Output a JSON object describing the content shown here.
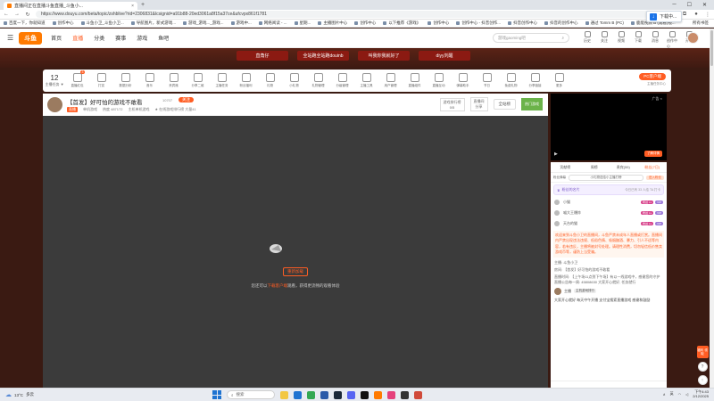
{
  "browser": {
    "tab_title": "直播间正在直播斗鱼直播_斗鱼小...",
    "new_tab": "+",
    "url": "https://www.douyu.com/beta/topic/zshblive?rid=2306831&lcsignid=a91b88-20ed3061a8f15a37ce&ufcvpx861f1781",
    "download_popup": "下载中...",
    "bookmarks": [
      "百度一下，你就知道",
      "创作中心",
      "斗鱼小卫_斗鱼小卫...",
      "导航图片，新式游戏...",
      "游戏_游戏..._游戏...",
      "游戏中...",
      "网络阅读 - ...",
      "星期...",
      "主播图片中心",
      "创作中心",
      "以下推荐《游戏》",
      "创作中心",
      "创作中心 - 抖音创作...",
      "抖音创作中心",
      "抖音的创作中心",
      "通过 Tomm B (PC)",
      "鹿能视频 B (观看)视..."
    ],
    "bookmarks_right": "所有书签"
  },
  "header": {
    "logo": "斗鱼",
    "nav": [
      "首页",
      "直播",
      "分类",
      "赛事",
      "游戏",
      "鱼吧"
    ],
    "active_nav": "直播",
    "search_placeholder": "游戏gaoming吧",
    "icons": [
      {
        "name": "history",
        "label": "历史"
      },
      {
        "name": "follow",
        "label": "关注"
      },
      {
        "name": "video",
        "label": "视频"
      },
      {
        "name": "download",
        "label": "下载"
      },
      {
        "name": "message",
        "label": "消息"
      },
      {
        "name": "creator",
        "label": "创作中心"
      },
      {
        "name": "broadcast",
        "label": "开播"
      }
    ]
  },
  "banner": {
    "buttons": [
      "直角仔",
      "全站跑全站跑douinb",
      "叫我你我就好了",
      "diyy刘醒"
    ]
  },
  "gift_bar": {
    "level_value": "12",
    "level_label": "主播任务 ▼",
    "gifts": [
      {
        "label": "直播红包",
        "badge": "3"
      },
      {
        "label": "打赏",
        "badge": ""
      },
      {
        "label": "数据分析",
        "badge": ""
      },
      {
        "label": "音乐",
        "badge": ""
      },
      {
        "label": "贵宾席",
        "badge": ""
      },
      {
        "label": "分享二维",
        "badge": ""
      },
      {
        "label": "主播任务",
        "badge": ""
      },
      {
        "label": "粉丝福利",
        "badge": ""
      },
      {
        "label": "礼物",
        "badge": ""
      },
      {
        "label": "小礼物",
        "badge": ""
      },
      {
        "label": "礼物管理",
        "badge": ""
      },
      {
        "label": "分级管理",
        "badge": ""
      },
      {
        "label": "主播工具",
        "badge": ""
      },
      {
        "label": "用户管理",
        "badge": ""
      },
      {
        "label": "直播组件",
        "badge": ""
      },
      {
        "label": "直播互动",
        "badge": ""
      },
      {
        "label": "弹幕助手",
        "badge": ""
      },
      {
        "label": "节日",
        "badge": ""
      },
      {
        "label": "免费礼物",
        "badge": ""
      },
      {
        "label": "分享链接",
        "badge": ""
      },
      {
        "label": "更多",
        "badge": ""
      }
    ],
    "pc_client": "PC客户端",
    "pc_sub": "主播任务中心"
  },
  "room": {
    "title": "【首发】好可怕的游戏不敢看",
    "follow_count": "10707",
    "follow_label": "关注",
    "live_tag": "直播",
    "category": "单机游戏",
    "meta": [
      "热度 487172",
      "主机单机游戏",
      "★ 在线游戏排行榜 大量41"
    ],
    "right_box_top": "游戏排行榜",
    "right_box_bottom": "0/5",
    "right_btn1": "直播间",
    "right_btn2": "分享",
    "right_btn3": "全站榜",
    "ad": "热门游戏"
  },
  "player": {
    "reload": "重新加载",
    "tip_before": "您还可以",
    "tip_link": "下载客户端",
    "tip_after": "观看，获得更流畅的观看体验"
  },
  "right_ad": {
    "label": "广告 ×",
    "btn": "了解详情"
  },
  "chat": {
    "tabs": [
      "贡献榜",
      "周榜",
      "贵宾(55)",
      "粉丝(7日)"
    ],
    "active_tab": "粉丝(7日)",
    "fan_row": [
      "粉丝弹幕",
      "小礼物送给小主播打榜",
      "进入粉丝"
    ],
    "fan_card_title": "粉丝的名片",
    "fan_card_sub": "今日已有 33 人给 TA 打卡",
    "ranks": [
      {
        "name": "小猫",
        "b1": "粉丝 Lv",
        "b2": "VIP"
      },
      {
        "name": "喵大王爆炸",
        "b1": "粉丝 Lv",
        "b2": "VIP"
      },
      {
        "name": "天台的猫",
        "b1": "粉丝 Lv",
        "b2": "VIP"
      }
    ],
    "notice": "欢迎来到斗鱼小卫的直播间，斗鱼严禁未成年人直播或打赏。直播间内严禁出现违法违规、低俗色情、吸烟酗酒、暴力、引人不适等内容，若有违反，主播将被封号处理。请理性消费，切勿轻信低价售卖游戏币等，谨防上当受骗。",
    "lines": [
      "主播: 斗鱼小卫",
      "房间: 【首发】好可怕的游戏不敢看",
      "直播时间: 【上午场11点到下午场】有以一线游戏中，感谢您的守护 直播公告每一周: 45808630 大家开心就好, 任务就行"
    ],
    "user": {
      "name": "主播",
      "level": "主机游戏排行"
    },
    "last_line": "大家开心就好 每天中午开播 支付宝搜索直播游戏 感谢和鼓励"
  },
  "side_tools": {
    "hot": "福利\n领取",
    "t1": "?",
    "t2": "↑"
  },
  "taskbar": {
    "weather": "13°C",
    "weather_desc": "多云",
    "search": "搜索",
    "time": "下午4:43",
    "date": "2/12/2025",
    "lang": "英"
  }
}
